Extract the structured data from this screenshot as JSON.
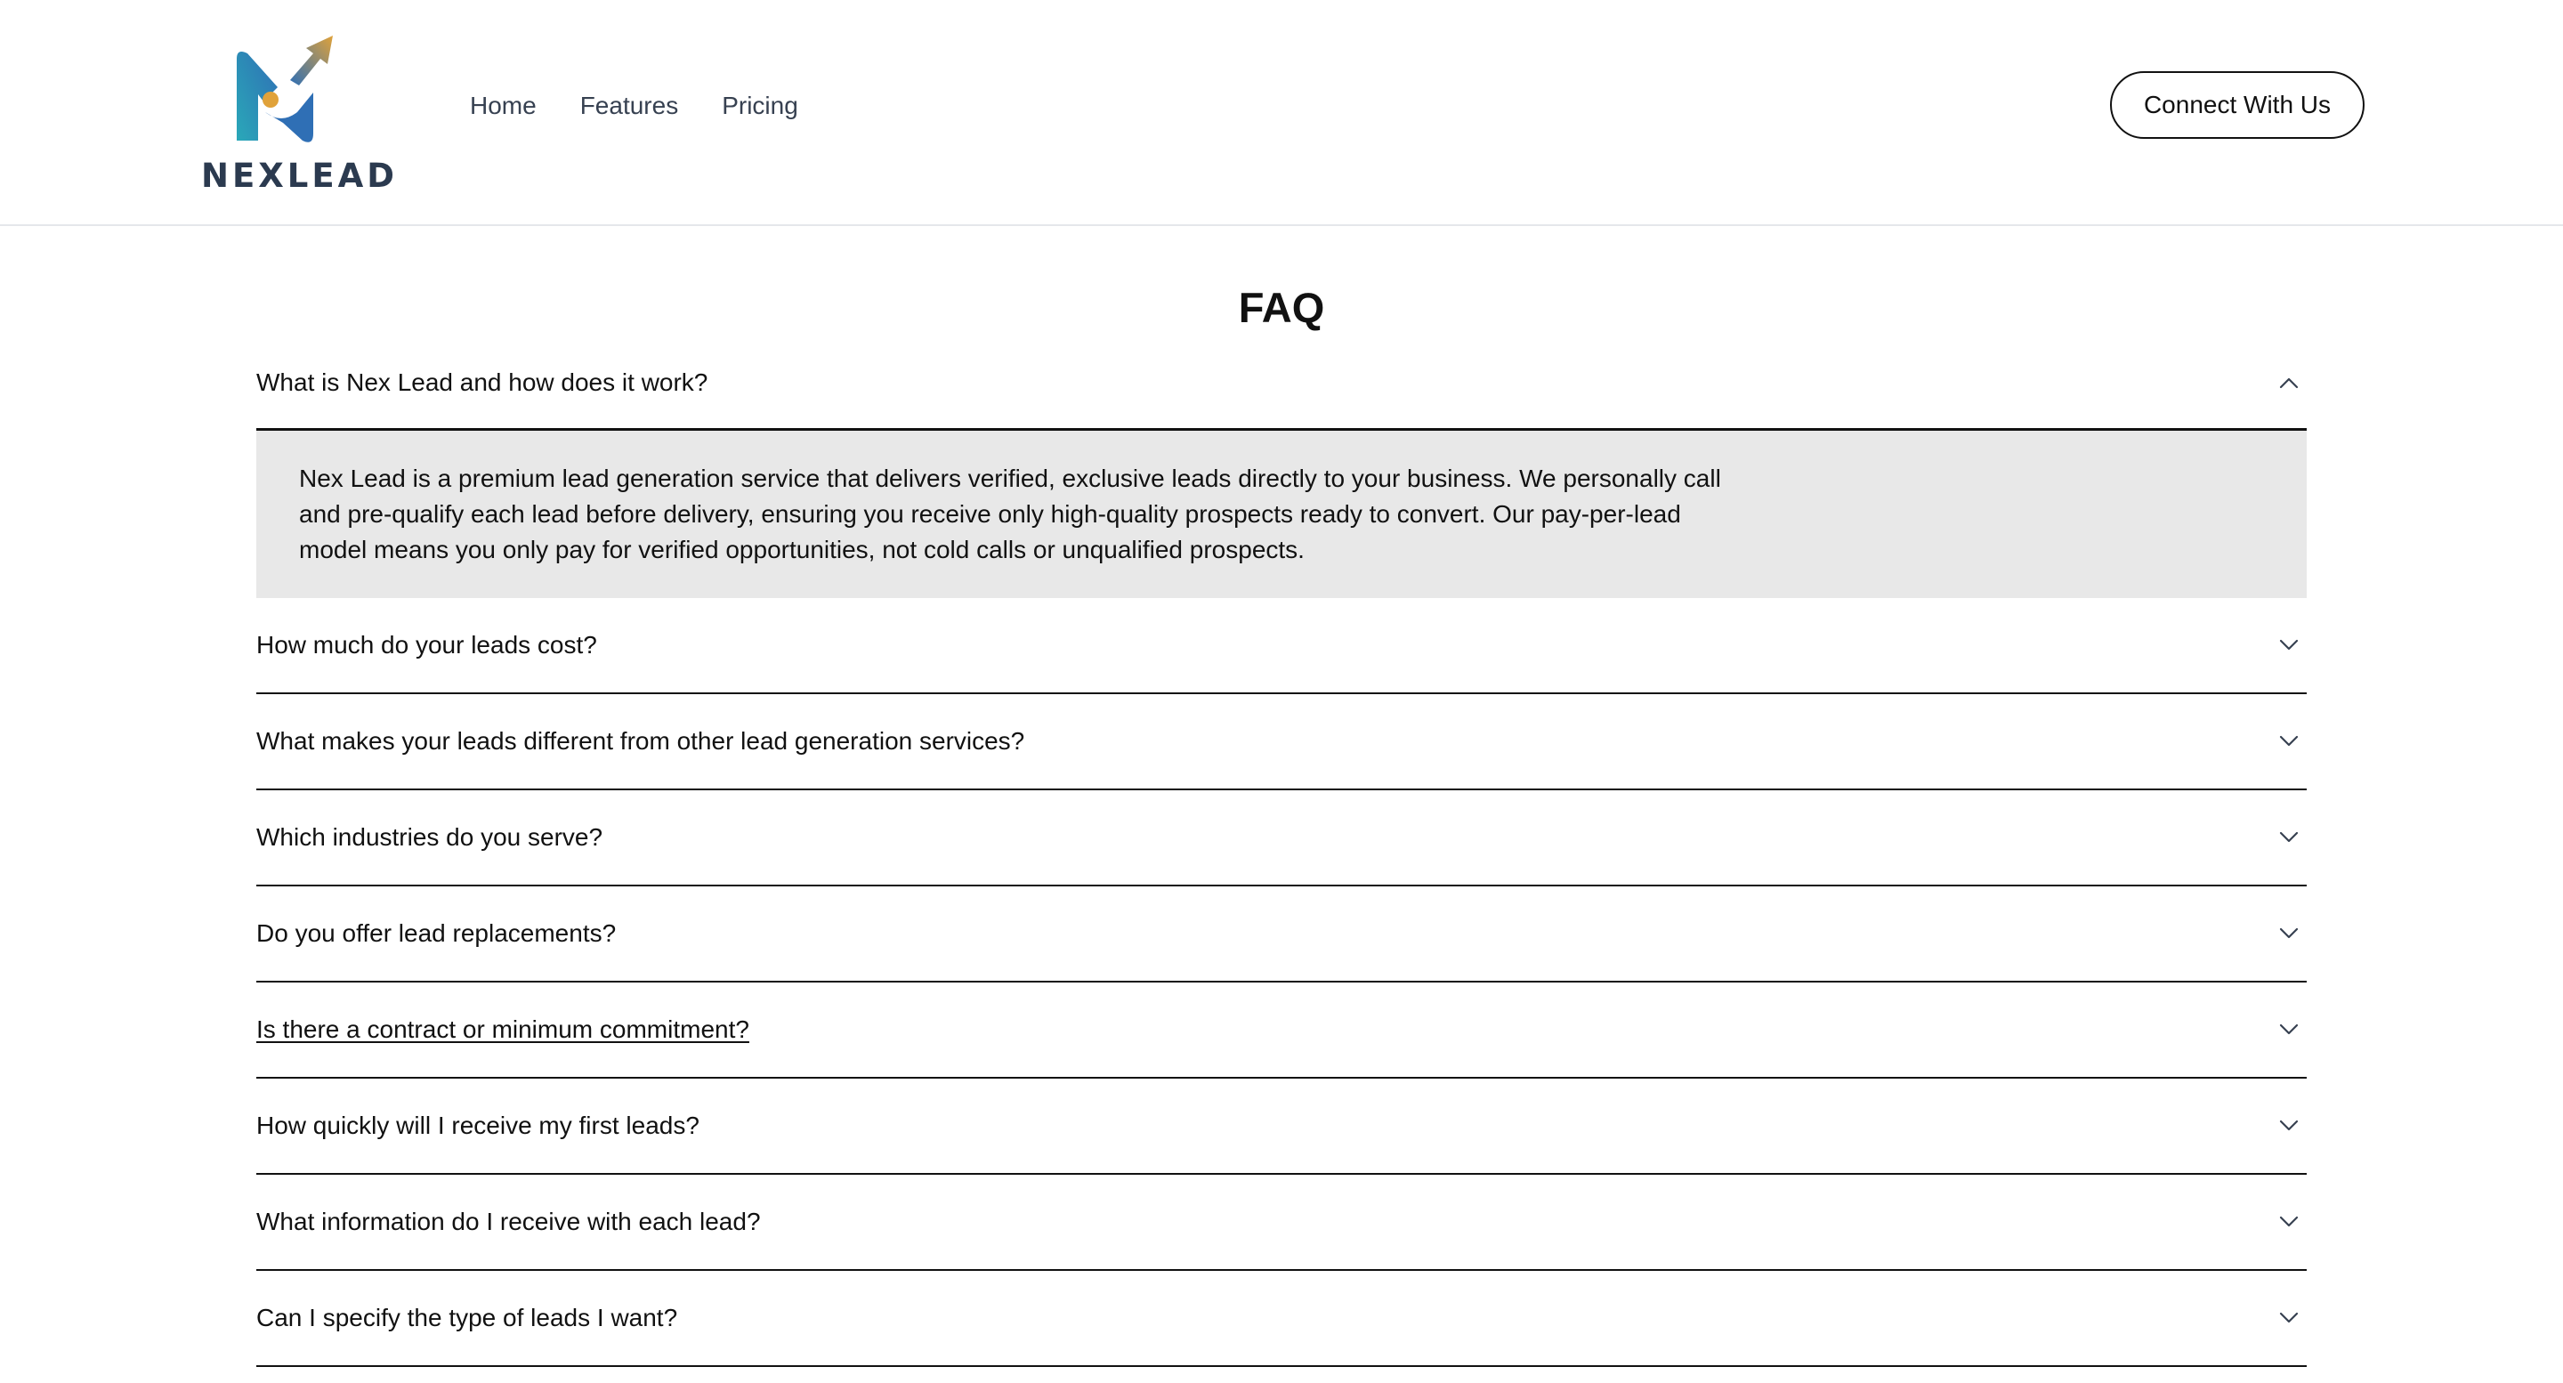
{
  "header": {
    "logo_text": "NEXLEAD",
    "nav": [
      "Home",
      "Features",
      "Pricing"
    ],
    "cta_label": "Connect With Us"
  },
  "faq": {
    "title": "FAQ",
    "items": [
      {
        "question": "What is Nex Lead and how does it work?",
        "expanded": true,
        "answer": "Nex Lead is a premium lead generation service that delivers verified, exclusive leads directly to your business. We personally call and pre-qualify each lead before delivery, ensuring you receive only high-quality prospects ready to convert. Our pay-per-lead model means you only pay for verified opportunities, not cold calls or unqualified prospects."
      },
      {
        "question": "How much do your leads cost?",
        "expanded": false
      },
      {
        "question": "What makes your leads different from other lead generation services?",
        "expanded": false
      },
      {
        "question": "Which industries do you serve?",
        "expanded": false
      },
      {
        "question": "Do you offer lead replacements?",
        "expanded": false
      },
      {
        "question": "Is there a contract or minimum commitment?",
        "expanded": false,
        "hovered": true
      },
      {
        "question": "How quickly will I receive my first leads?",
        "expanded": false
      },
      {
        "question": "What information do I receive with each lead?",
        "expanded": false
      },
      {
        "question": "Can I specify the type of leads I want?",
        "expanded": false
      }
    ]
  },
  "colors": {
    "logo_blue": "#2f6fb5",
    "logo_teal": "#2aa8b8",
    "logo_gold": "#e0a23a",
    "answer_bg": "#e8e8e8"
  },
  "icons": {
    "collapse": "chevron-up-icon",
    "expand": "chevron-down-icon"
  }
}
